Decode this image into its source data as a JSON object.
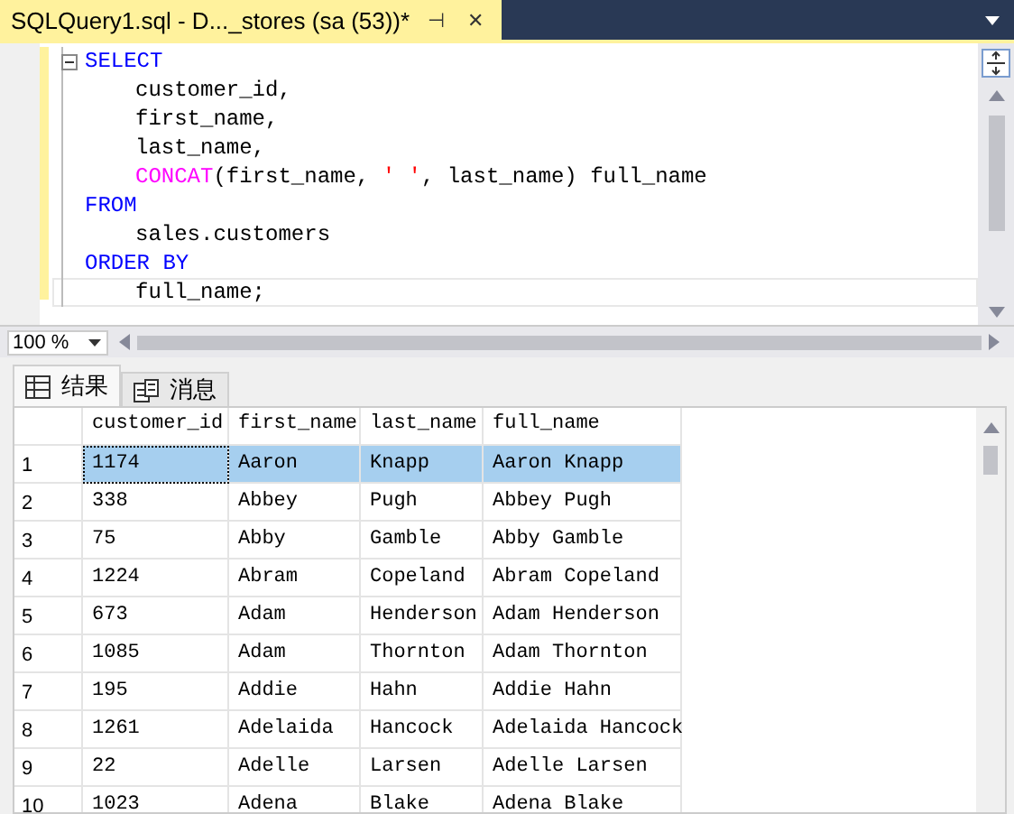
{
  "document_tab": {
    "title": "SQLQuery1.sql - D..._stores (sa (53))*",
    "pin": "⊣",
    "close": "✕"
  },
  "editor": {
    "lines": [
      {
        "indented": false,
        "current": false,
        "foldable": true,
        "segments": [
          {
            "kind": "keyword",
            "text": "SELECT"
          }
        ]
      },
      {
        "indented": true,
        "current": false,
        "foldable": false,
        "segments": [
          {
            "kind": "plain",
            "text": "customer_id,"
          }
        ]
      },
      {
        "indented": true,
        "current": false,
        "foldable": false,
        "segments": [
          {
            "kind": "plain",
            "text": "first_name,"
          }
        ]
      },
      {
        "indented": true,
        "current": false,
        "foldable": false,
        "segments": [
          {
            "kind": "plain",
            "text": "last_name,"
          }
        ]
      },
      {
        "indented": true,
        "current": false,
        "foldable": false,
        "segments": [
          {
            "kind": "function",
            "text": "CONCAT"
          },
          {
            "kind": "plain",
            "text": "(first_name, "
          },
          {
            "kind": "string",
            "text": "' '"
          },
          {
            "kind": "plain",
            "text": ", last_name) full_name"
          }
        ]
      },
      {
        "indented": false,
        "current": false,
        "foldable": false,
        "segments": [
          {
            "kind": "keyword",
            "text": "FROM"
          }
        ]
      },
      {
        "indented": true,
        "current": false,
        "foldable": false,
        "segments": [
          {
            "kind": "plain",
            "text": "sales.customers"
          }
        ]
      },
      {
        "indented": false,
        "current": false,
        "foldable": false,
        "segments": [
          {
            "kind": "keyword",
            "text": "ORDER BY"
          }
        ]
      },
      {
        "indented": true,
        "current": true,
        "foldable": false,
        "segments": [
          {
            "kind": "plain",
            "text": "full_name;"
          }
        ]
      }
    ]
  },
  "zoom": {
    "value": "100 %"
  },
  "result_tabs": [
    {
      "label": "结果",
      "kind": "grid",
      "selected": true
    },
    {
      "label": "消息",
      "kind": "messages",
      "selected": false
    }
  ],
  "table": {
    "columns": [
      "customer_id",
      "first_name",
      "last_name",
      "full_name"
    ],
    "rows": [
      {
        "number": "1",
        "selected": true,
        "cells": [
          "1174",
          "Aaron",
          "Knapp",
          "Aaron Knapp"
        ]
      },
      {
        "number": "2",
        "selected": false,
        "cells": [
          "338",
          "Abbey",
          "Pugh",
          "Abbey Pugh"
        ]
      },
      {
        "number": "3",
        "selected": false,
        "cells": [
          "75",
          "Abby",
          "Gamble",
          "Abby Gamble"
        ]
      },
      {
        "number": "4",
        "selected": false,
        "cells": [
          "1224",
          "Abram",
          "Copeland",
          "Abram Copeland"
        ]
      },
      {
        "number": "5",
        "selected": false,
        "cells": [
          "673",
          "Adam",
          "Henderson",
          "Adam Henderson"
        ]
      },
      {
        "number": "6",
        "selected": false,
        "cells": [
          "1085",
          "Adam",
          "Thornton",
          "Adam Thornton"
        ]
      },
      {
        "number": "7",
        "selected": false,
        "cells": [
          "195",
          "Addie",
          "Hahn",
          "Addie Hahn"
        ]
      },
      {
        "number": "8",
        "selected": false,
        "cells": [
          "1261",
          "Adelaida",
          "Hancock",
          "Adelaida Hancock"
        ]
      },
      {
        "number": "9",
        "selected": false,
        "cells": [
          "22",
          "Adelle",
          "Larsen",
          "Adelle Larsen"
        ]
      },
      {
        "number": "10",
        "selected": false,
        "cells": [
          "1023",
          "Adena",
          "Blake",
          "Adena Blake"
        ]
      }
    ]
  }
}
